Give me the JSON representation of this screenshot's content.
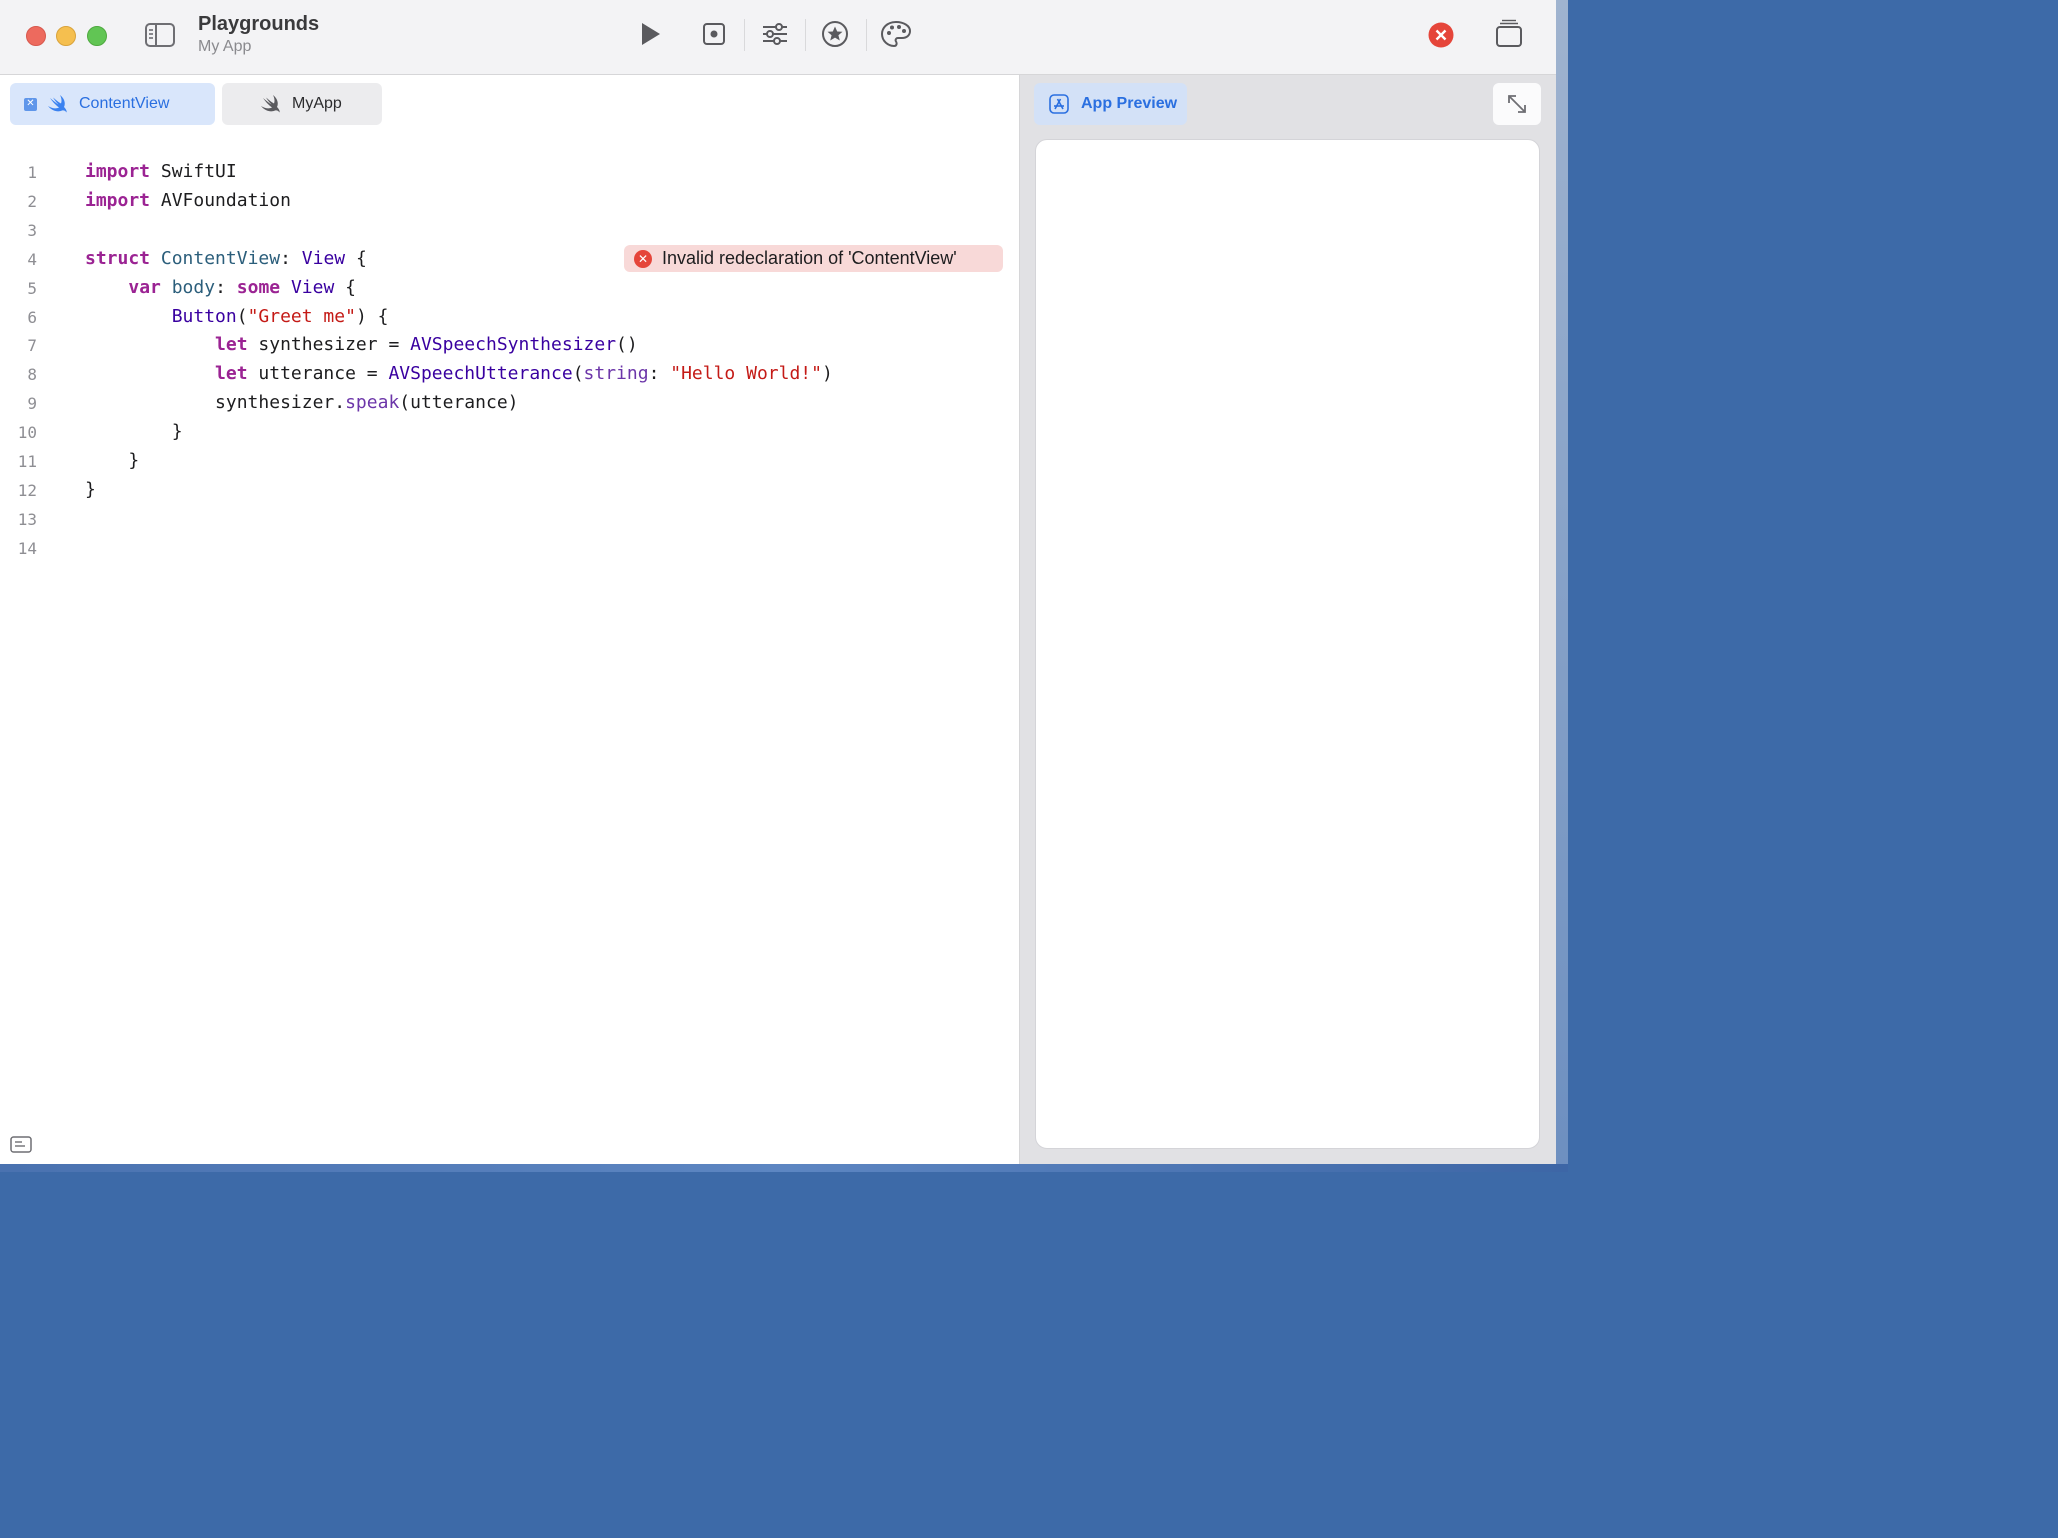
{
  "window": {
    "title": "Playgrounds",
    "subtitle": "My App"
  },
  "toolbar": {
    "icons": [
      "sidebar-toggle-icon",
      "play-icon",
      "stop-icon",
      "sliders-icon",
      "star-icon",
      "palette-icon",
      "error-icon",
      "windows-icon"
    ]
  },
  "tabs": [
    {
      "label": "ContentView",
      "active": true
    },
    {
      "label": "MyApp",
      "active": false
    }
  ],
  "code": {
    "line_numbers": [
      "1",
      "2",
      "3",
      "4",
      "5",
      "6",
      "7",
      "8",
      "9",
      "10",
      "11",
      "12",
      "13",
      "14"
    ],
    "lines": [
      [
        {
          "t": "import",
          "c": "kw"
        },
        {
          "t": " SwiftUI",
          "c": ""
        }
      ],
      [
        {
          "t": "import",
          "c": "kw"
        },
        {
          "t": " AVFoundation",
          "c": ""
        }
      ],
      [],
      [
        {
          "t": "struct",
          "c": "kw"
        },
        {
          "t": " ",
          "c": ""
        },
        {
          "t": "ContentView",
          "c": "pj"
        },
        {
          "t": ": ",
          "c": ""
        },
        {
          "t": "View",
          "c": "ty"
        },
        {
          "t": " {",
          "c": ""
        }
      ],
      [
        {
          "t": "    ",
          "c": ""
        },
        {
          "t": "var",
          "c": "kw"
        },
        {
          "t": " ",
          "c": ""
        },
        {
          "t": "body",
          "c": "pj"
        },
        {
          "t": ": ",
          "c": ""
        },
        {
          "t": "some",
          "c": "kw"
        },
        {
          "t": " ",
          "c": ""
        },
        {
          "t": "View",
          "c": "ty"
        },
        {
          "t": " {",
          "c": ""
        }
      ],
      [
        {
          "t": "        ",
          "c": ""
        },
        {
          "t": "Button",
          "c": "ty"
        },
        {
          "t": "(",
          "c": ""
        },
        {
          "t": "\"Greet me\"",
          "c": "st"
        },
        {
          "t": ") {",
          "c": ""
        }
      ],
      [
        {
          "t": "            ",
          "c": ""
        },
        {
          "t": "let",
          "c": "kw"
        },
        {
          "t": " synthesizer = ",
          "c": ""
        },
        {
          "t": "AVSpeechSynthesizer",
          "c": "ty"
        },
        {
          "t": "()",
          "c": ""
        }
      ],
      [
        {
          "t": "            ",
          "c": ""
        },
        {
          "t": "let",
          "c": "kw"
        },
        {
          "t": " utterance = ",
          "c": ""
        },
        {
          "t": "AVSpeechUtterance",
          "c": "ty"
        },
        {
          "t": "(",
          "c": ""
        },
        {
          "t": "string",
          "c": "fn"
        },
        {
          "t": ": ",
          "c": ""
        },
        {
          "t": "\"Hello World!\"",
          "c": "st"
        },
        {
          "t": ")",
          "c": ""
        }
      ],
      [
        {
          "t": "            synthesizer.",
          "c": ""
        },
        {
          "t": "speak",
          "c": "fn"
        },
        {
          "t": "(utterance)",
          "c": ""
        }
      ],
      [
        {
          "t": "        }",
          "c": ""
        }
      ],
      [
        {
          "t": "    }",
          "c": ""
        }
      ],
      [
        {
          "t": "}",
          "c": ""
        }
      ],
      [],
      []
    ]
  },
  "error": {
    "message": "Invalid redeclaration of 'ContentView'"
  },
  "preview": {
    "tab_label": "App Preview"
  },
  "colors": {
    "accent": "#2a6fe0",
    "error": "#e5453a",
    "keyword": "#9b2393",
    "type": "#3900a0",
    "string": "#c41a16"
  }
}
